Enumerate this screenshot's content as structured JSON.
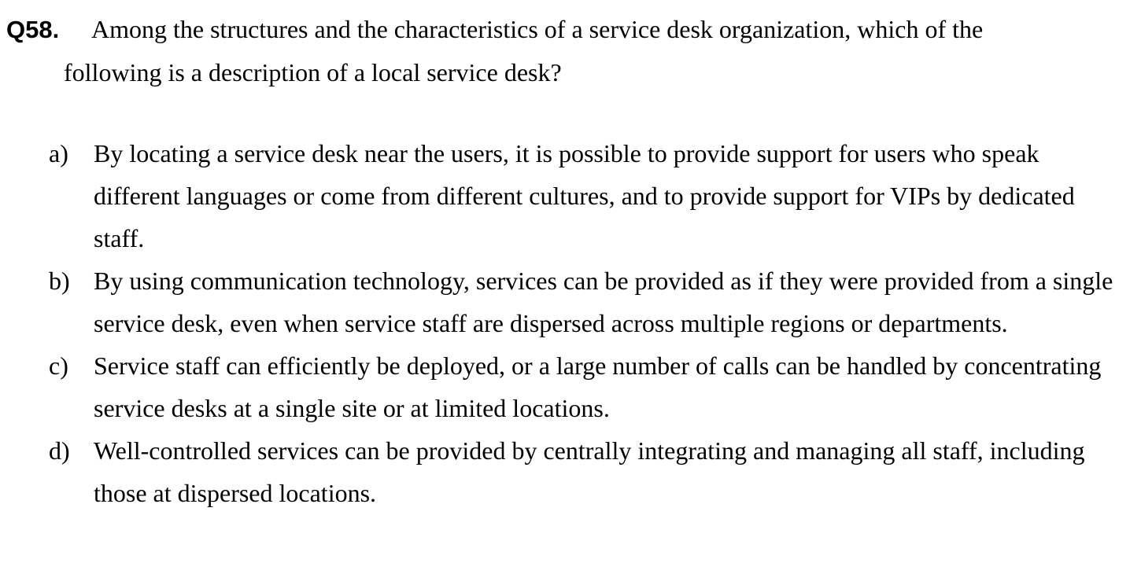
{
  "question": {
    "number": "Q58.",
    "text_line1": "Among the structures and the characteristics of a service desk organization, which of the",
    "text_line2": "following is a description of a local service desk?"
  },
  "options": [
    {
      "letter": "a)",
      "text": "By locating a service desk near the users, it is possible to provide support for users who speak different languages or come from different cultures, and to provide support for VIPs by dedicated staff."
    },
    {
      "letter": "b)",
      "text": "By using communication technology, services can be provided as if they were provided from a single service desk, even when service staff are dispersed across multiple regions or departments."
    },
    {
      "letter": "c)",
      "text": "Service staff can efficiently be deployed, or a large number of calls can be handled by concentrating service desks at a single site or at limited locations."
    },
    {
      "letter": "d)",
      "text": "Well-controlled services can be provided by centrally integrating and managing all staff, including those at dispersed locations."
    }
  ]
}
